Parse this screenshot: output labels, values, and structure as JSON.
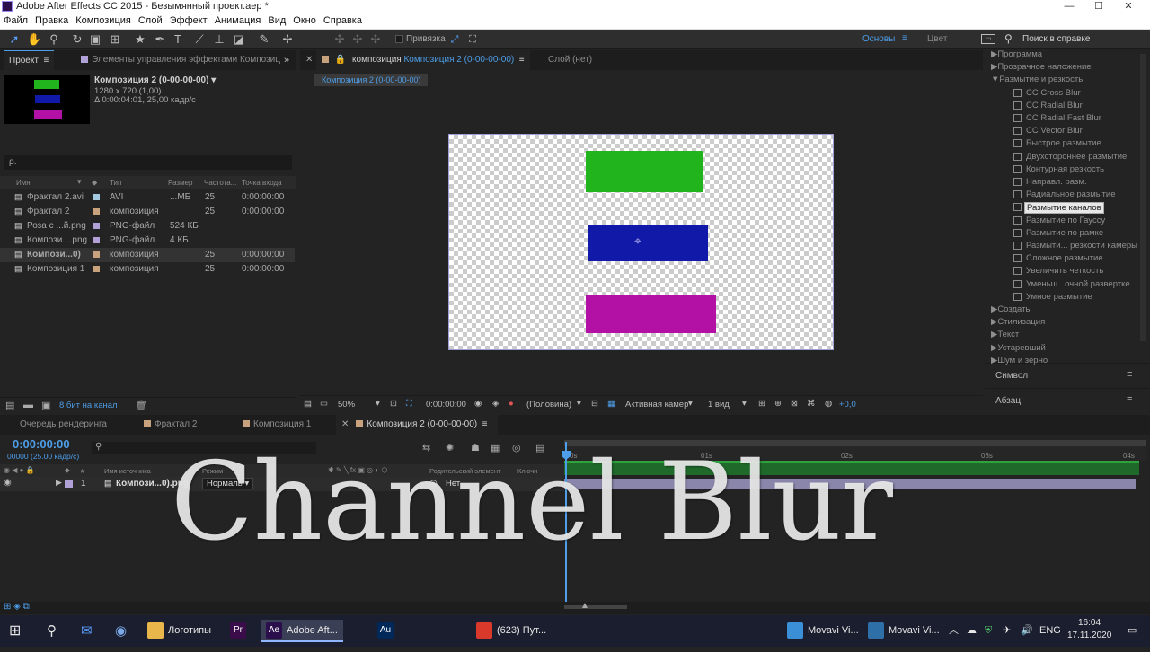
{
  "window": {
    "title": "Adobe After Effects CC 2015 - Безымянный проект.aep *",
    "minimize": "—",
    "maximize": "☐",
    "close": "✕"
  },
  "menu": [
    "Файл",
    "Правка",
    "Композиция",
    "Слой",
    "Эффект",
    "Анимация",
    "Вид",
    "Окно",
    "Справка"
  ],
  "toolbar": {
    "snap_label": "Привязка",
    "workspace_active": "Основы",
    "workspace_other": "Цвет",
    "search_placeholder": "Поиск в справке"
  },
  "project": {
    "tab_project": "Проект",
    "tab_effects": "Элементы управления эффектами Композиц",
    "comp_name": "Композиция 2 (0-00-00-00) ▾",
    "comp_size": "1280 x 720 (1,00)",
    "comp_duration": "Δ 0:00:04:01, 25,00 кадр/с",
    "search_placeholder": "ρ.",
    "columns": [
      "Имя",
      "Тип",
      "Размер",
      "Частота...",
      "Точка входа"
    ],
    "items": [
      {
        "name": "Фрактал 2.avi",
        "type": "AVI",
        "size": "...МБ",
        "fps": "25",
        "in": "0:00:00:00",
        "color": "#a6c9e2"
      },
      {
        "name": "Фрактал 2",
        "type": "композиция",
        "size": "",
        "fps": "25",
        "in": "0:00:00:00",
        "color": "#c7a27c"
      },
      {
        "name": "Роза с ...й.png",
        "type": "PNG-файл",
        "size": "524 КБ",
        "fps": "",
        "in": "",
        "color": "#b0a1d6"
      },
      {
        "name": "Компози....png",
        "type": "PNG-файл",
        "size": "4 КБ",
        "fps": "",
        "in": "",
        "color": "#b0a1d6"
      },
      {
        "name": "Компози...0)",
        "type": "композиция",
        "size": "",
        "fps": "25",
        "in": "0:00:00:00",
        "color": "#c7a27c"
      },
      {
        "name": "Композиция 1",
        "type": "композиция",
        "size": "",
        "fps": "25",
        "in": "0:00:00:00",
        "color": "#c7a27c"
      }
    ],
    "bit_depth": "8 бит на канал"
  },
  "viewer": {
    "tab_comp_prefix": "композиция",
    "tab_comp_name": "Композиция 2 (0-00-00-00)",
    "tab_layer": "Слой (нет)",
    "breadcrumb": "Композиция 2 (0-00-00-00)",
    "zoom": "50%",
    "timecode": "0:00:00:00",
    "resolution": "(Половина)",
    "camera": "Активная камер",
    "views": "1 вид",
    "exposure": "+0,0",
    "rect_colors": [
      "#22b41d",
      "#1119a8",
      "#b310a5"
    ]
  },
  "effects_panel": {
    "categories_top": [
      "Программа",
      "Прозрачное наложение"
    ],
    "open_category": "Размытие и резкость",
    "items": [
      "CC Cross Blur",
      "CC Radial Blur",
      "CC Radial Fast Blur",
      "CC Vector Blur",
      "Быстрое размытие",
      "Двухстороннее размытие",
      "Контурная резкость",
      "Направл. разм.",
      "Радиальное размытие",
      "Размытие каналов",
      "Размытие по Гауссу",
      "Размытие по рамке",
      "Размыти... резкости камеры",
      "Сложное размытие",
      "Увеличить четкость",
      "Уменьш...очной развертке",
      "Умное размытие"
    ],
    "selected_item": "Размытие каналов",
    "categories_bottom": [
      "Создать",
      "Стилизация",
      "Текст",
      "Устаревший",
      "Шум и зерно"
    ],
    "panel_symbol": "Символ",
    "panel_paragraph": "Абзац"
  },
  "timeline": {
    "tabs": [
      "Очередь рендеринга",
      "Фрактал 2",
      "Композиция 1",
      "Композиция 2 (0-00-00-00)"
    ],
    "timecode": "0:00:00:00",
    "frame_info": "00000 (25.00 кадр/с)",
    "columns": [
      "Имя источника",
      "Режим",
      "Т",
      "Родительский элемент",
      "Ключи"
    ],
    "layer": {
      "num": "1",
      "name": "Компози...0).png",
      "mode": "Нормаль ▾",
      "parent": "Нет"
    },
    "ruler": [
      "0s",
      "01s",
      "02s",
      "03s",
      "04s"
    ]
  },
  "overlay_text": "Channel Blur",
  "taskbar": {
    "items": [
      {
        "label": "Логотипы",
        "color": "#e8b64a"
      },
      {
        "label": "",
        "color": "#3a0d4a",
        "glyph": "Pr"
      },
      {
        "label": "Adobe Aft...",
        "color": "#2b0f4c",
        "glyph": "Ae"
      },
      {
        "label": "",
        "color": "#00295a",
        "glyph": "Au"
      },
      {
        "label": "(623) Пут...",
        "color": "#d9392b"
      },
      {
        "label": "Movavi Vi...",
        "color": "#3b8fd6"
      },
      {
        "label": "Movavi Vi...",
        "color": "#2f6fa8"
      }
    ],
    "lang": "ENG",
    "time": "16:04",
    "date": "17.11.2020"
  }
}
